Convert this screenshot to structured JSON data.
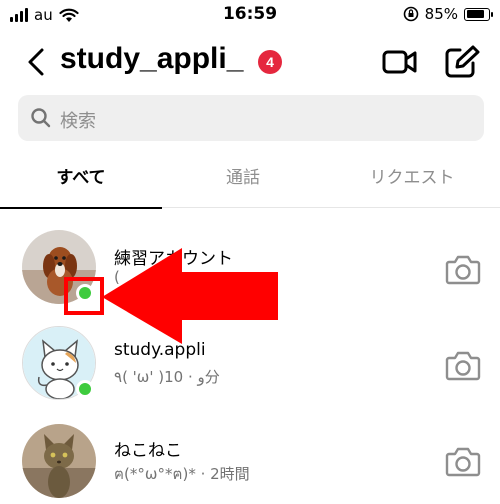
{
  "status_bar": {
    "carrier": "au",
    "time": "16:59",
    "battery_text": "85%",
    "battery_level": 0.85,
    "icons": [
      "signal-bars-icon",
      "wifi-icon",
      "orientation-lock-icon",
      "battery-icon"
    ]
  },
  "header": {
    "back_icon": "chevron-left-icon",
    "username": "study_appli_",
    "badge_count": "4",
    "badge_color": "#e5273e",
    "video_icon": "video-camera-icon",
    "compose_icon": "edit-icon"
  },
  "search": {
    "placeholder": "検索",
    "icon": "search-icon"
  },
  "tabs": [
    {
      "label": "すべて",
      "active": true
    },
    {
      "label": "通話",
      "active": false
    },
    {
      "label": "リクエスト",
      "active": false
    }
  ],
  "threads": [
    {
      "name": "練習アカウント",
      "preview": "(",
      "online": true,
      "avatar": "dog-photo"
    },
    {
      "name": "study.appli",
      "preview": "٩( 'ω' )و · 10分",
      "online": true,
      "avatar": "cat-illustration"
    },
    {
      "name": "ねこねこ",
      "preview": "ฅ(*°ω°*ฅ)* · 2時間",
      "online": false,
      "avatar": "cat-photo"
    }
  ],
  "annotation": {
    "color": "#ff0000",
    "target": "online-indicator"
  },
  "colors": {
    "online_dot": "#3ecb3e",
    "secondary_text": "#737373",
    "search_bg": "#efefef"
  }
}
